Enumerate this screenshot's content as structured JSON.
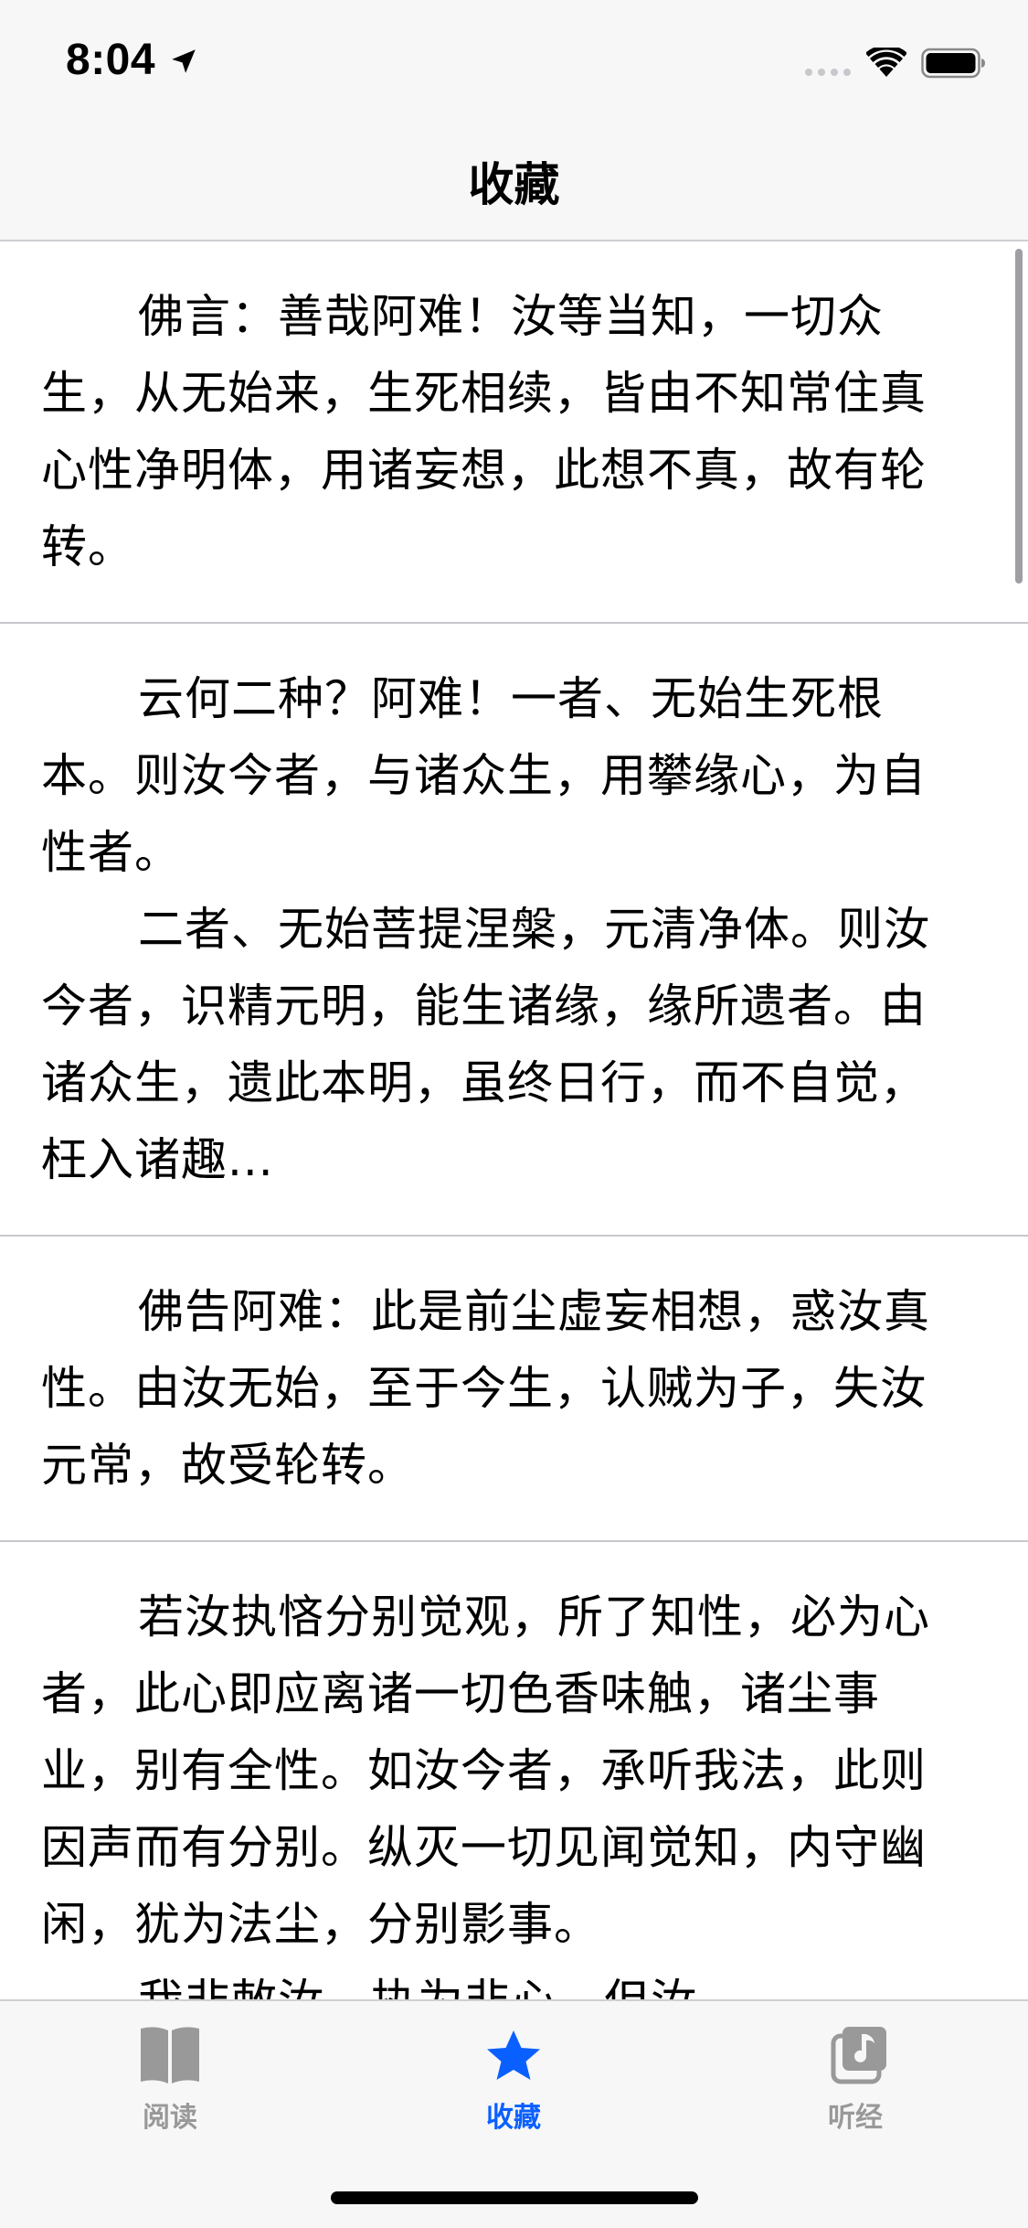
{
  "status_bar": {
    "time": "8:04"
  },
  "nav_bar": {
    "title": "收藏"
  },
  "favorites": [
    {
      "paragraphs": [
        "佛言：善哉阿难！汝等当知，一切众生，从无始来，生死相续，皆由不知常住真心性净明体，用诸妄想，此想不真，故有轮转。"
      ]
    },
    {
      "paragraphs": [
        "云何二种？阿难！一者、无始生死根本。则汝今者，与诸众生，用攀缘心，为自性者。",
        "二者、无始菩提涅槃，元清净体。则汝今者，识精元明，能生诸缘，缘所遗者。由诸众生，遗此本明，虽终日行，而不自觉，枉入诸趣..."
      ]
    },
    {
      "paragraphs": [
        "佛告阿难：此是前尘虚妄相想，惑汝真性。由汝无始，至于今生，认贼为子，失汝元常，故受轮转。"
      ]
    },
    {
      "paragraphs": [
        "若汝执悋分别觉观，所了知性，必为心者，此心即应离诸一切色香味触，诸尘事业，别有全性。如汝今者，承听我法，此则因声而有分别。纵灭一切见闻觉知，内守幽闲，犹为法尘，分别影事。",
        "我非敕汝，执为非心，但汝..."
      ]
    }
  ],
  "tab_bar": {
    "tabs": [
      {
        "label": "阅读",
        "icon": "book-icon",
        "selected": false
      },
      {
        "label": "收藏",
        "icon": "star-icon",
        "selected": true
      },
      {
        "label": "听经",
        "icon": "music-note-icon",
        "selected": false
      }
    ]
  },
  "colors": {
    "accent": "#0a60ff",
    "inactive_tab": "#999999",
    "bar_background": "#f7f7f7",
    "separator": "#c8c7cc"
  }
}
